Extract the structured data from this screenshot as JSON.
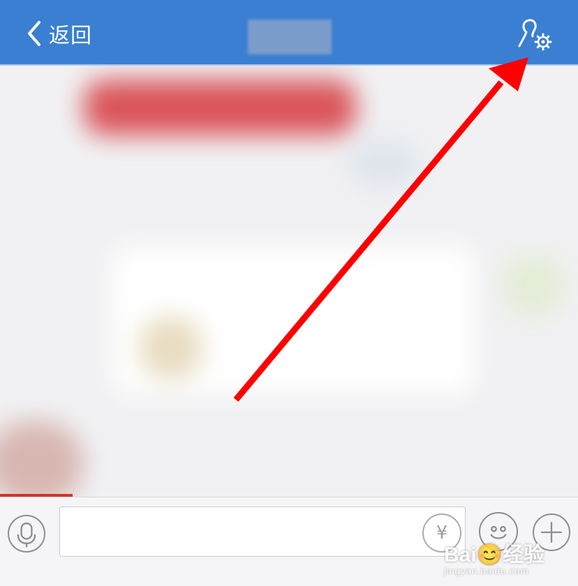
{
  "header": {
    "back_label": "返回",
    "title": "",
    "settings_icon": "user-settings-icon",
    "background": "#3a7fd1"
  },
  "annotation": {
    "type": "arrow",
    "color": "#ff0000"
  },
  "composer": {
    "input_value": "",
    "mic_icon": "microphone-icon",
    "yen_symbol": "¥",
    "emoji_icon": "emoji-icon",
    "plus_icon": "plus-icon"
  },
  "watermark": {
    "brand": "Bai😊经验",
    "url": "jingyan.baidu.com"
  }
}
